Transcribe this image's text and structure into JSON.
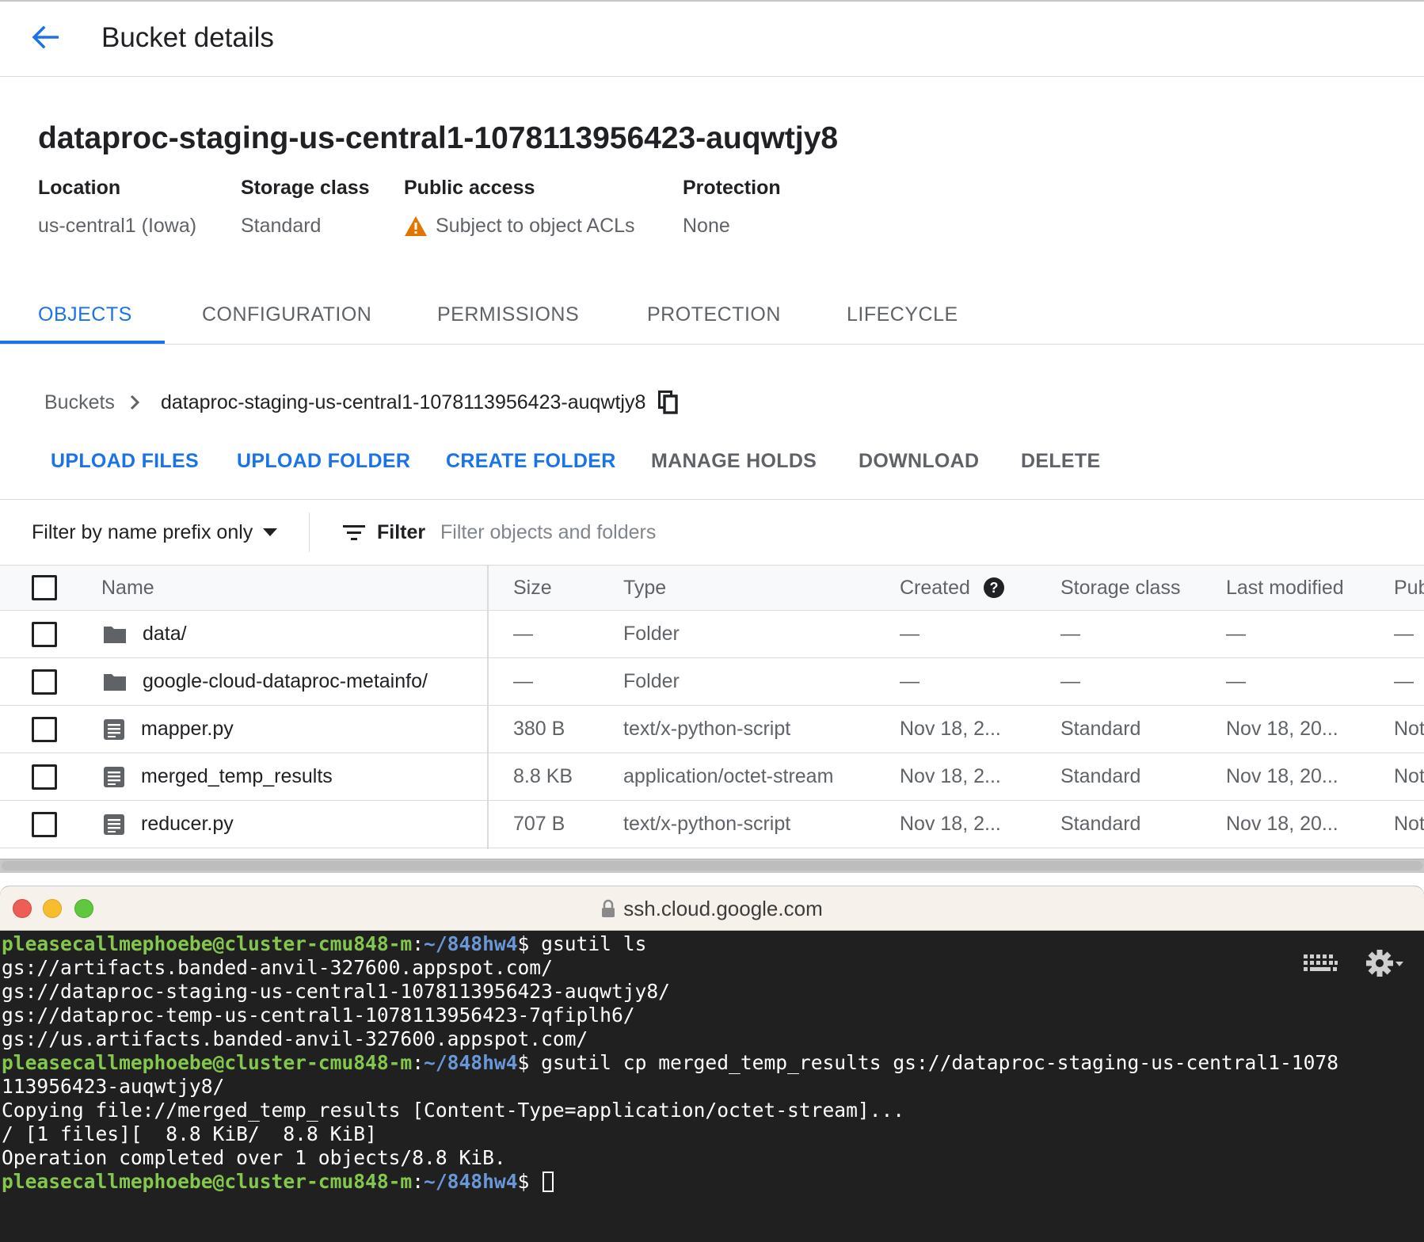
{
  "header": {
    "title": "Bucket details"
  },
  "bucket": {
    "name": "dataproc-staging-us-central1-1078113956423-auqwtjy8",
    "meta": [
      {
        "label": "Location",
        "value": "us-central1 (Iowa)"
      },
      {
        "label": "Storage class",
        "value": "Standard"
      },
      {
        "label": "Public access",
        "value": "Subject to object ACLs",
        "warning_color": "#e37400"
      },
      {
        "label": "Protection",
        "value": "None"
      }
    ]
  },
  "tabs": [
    {
      "label": "OBJECTS",
      "active": true
    },
    {
      "label": "CONFIGURATION"
    },
    {
      "label": "PERMISSIONS"
    },
    {
      "label": "PROTECTION"
    },
    {
      "label": "LIFECYCLE"
    }
  ],
  "breadcrumb": {
    "root": "Buckets",
    "current": "dataproc-staging-us-central1-1078113956423-auqwtjy8"
  },
  "actions": [
    {
      "label": "UPLOAD FILES",
      "enabled": true
    },
    {
      "label": "UPLOAD FOLDER",
      "enabled": true
    },
    {
      "label": "CREATE FOLDER",
      "enabled": true
    },
    {
      "label": "MANAGE HOLDS",
      "enabled": false
    },
    {
      "label": "DOWNLOAD",
      "enabled": false
    },
    {
      "label": "DELETE",
      "enabled": false
    }
  ],
  "filter": {
    "mode": "Filter by name prefix only",
    "button": "Filter",
    "placeholder": "Filter objects and folders"
  },
  "table": {
    "columns": [
      "Name",
      "Size",
      "Type",
      "Created",
      "Storage class",
      "Last modified",
      "Pub"
    ],
    "rows": [
      {
        "kind": "folder",
        "name": "data/",
        "size": "—",
        "type": "Folder",
        "created": "—",
        "storage": "—",
        "modified": "—",
        "public": "—"
      },
      {
        "kind": "folder",
        "name": "google-cloud-dataproc-metainfo/",
        "size": "—",
        "type": "Folder",
        "created": "—",
        "storage": "—",
        "modified": "—",
        "public": "—"
      },
      {
        "kind": "file",
        "name": "mapper.py",
        "size": "380 B",
        "type": "text/x-python-script",
        "created": "Nov 18, 2...",
        "storage": "Standard",
        "modified": "Nov 18, 20...",
        "public": "Not"
      },
      {
        "kind": "file",
        "name": "merged_temp_results",
        "size": "8.8 KB",
        "type": "application/octet-stream",
        "created": "Nov 18, 2...",
        "storage": "Standard",
        "modified": "Nov 18, 20...",
        "public": "Not"
      },
      {
        "kind": "file",
        "name": "reducer.py",
        "size": "707 B",
        "type": "text/x-python-script",
        "created": "Nov 18, 2...",
        "storage": "Standard",
        "modified": "Nov 18, 20...",
        "public": "Not"
      }
    ]
  },
  "terminal": {
    "url": "ssh.cloud.google.com",
    "prompt_user": "pleasecallmephoebe@cluster-cmu848-m",
    "prompt_path": "~/848hw4",
    "lines": [
      {
        "prompt": true,
        "cmd": "gsutil ls"
      },
      {
        "text": "gs://artifacts.banded-anvil-327600.appspot.com/"
      },
      {
        "text": "gs://dataproc-staging-us-central1-1078113956423-auqwtjy8/"
      },
      {
        "text": "gs://dataproc-temp-us-central1-1078113956423-7qfiplh6/"
      },
      {
        "text": "gs://us.artifacts.banded-anvil-327600.appspot.com/"
      },
      {
        "prompt": true,
        "cmd": "gsutil cp merged_temp_results gs://dataproc-staging-us-central1-1078"
      },
      {
        "text": "113956423-auqwtjy8/"
      },
      {
        "text": "Copying file://merged_temp_results [Content-Type=application/octet-stream]..."
      },
      {
        "text": "/ [1 files][  8.8 KiB/  8.8 KiB]"
      },
      {
        "text": "Operation completed over 1 objects/8.8 KiB."
      },
      {
        "prompt": true,
        "cmd": "",
        "cursor": true
      }
    ]
  },
  "colors": {
    "accent": "#1a73e8",
    "prompt_user": "#84c74d",
    "prompt_path": "#6a97d8"
  }
}
